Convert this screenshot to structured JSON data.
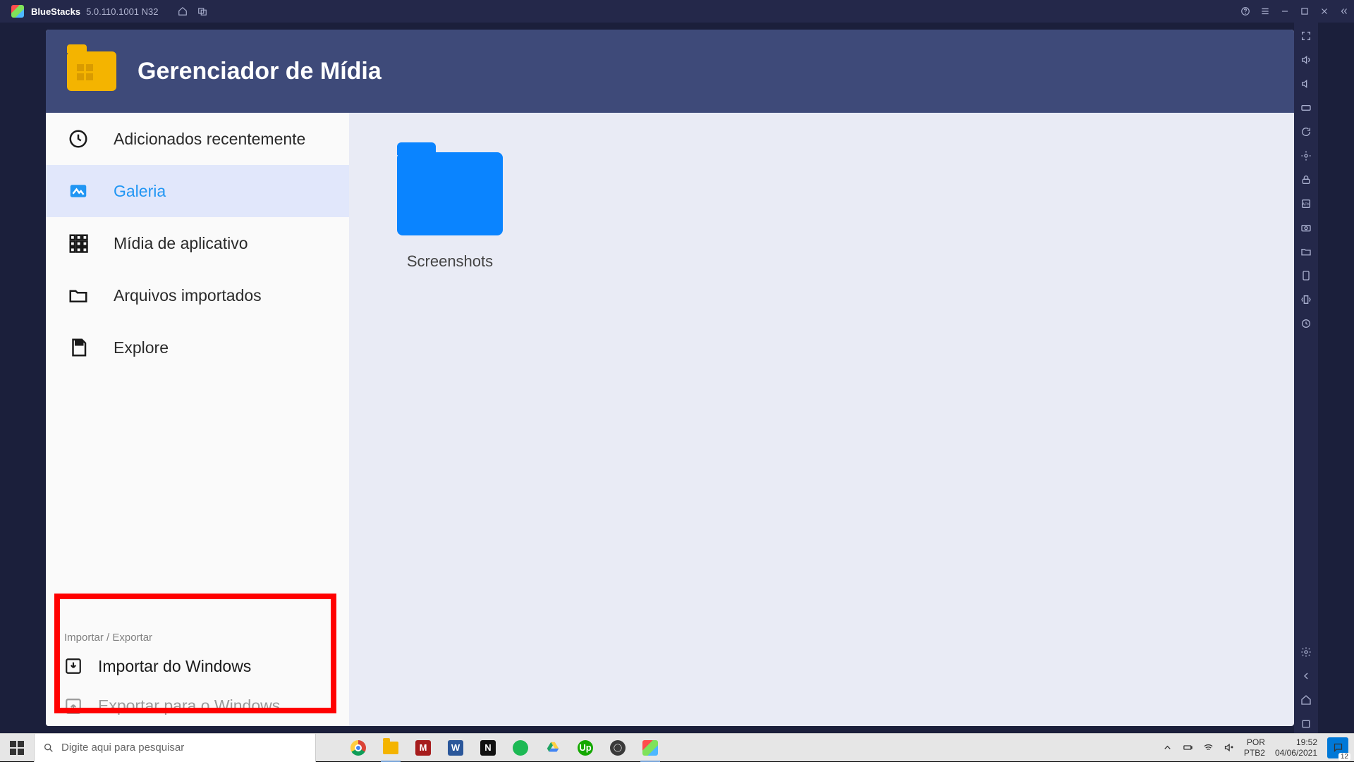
{
  "bluestacks": {
    "name": "BlueStacks",
    "version": "5.0.110.1001 N32"
  },
  "app": {
    "title": "Gerenciador de Mídia"
  },
  "sidebar": {
    "items": [
      {
        "label": "Adicionados recentemente"
      },
      {
        "label": "Galeria"
      },
      {
        "label": "Mídia de aplicativo"
      },
      {
        "label": "Arquivos importados"
      },
      {
        "label": "Explore"
      }
    ],
    "impexp_header": "Importar / Exportar",
    "impexp": [
      {
        "label": "Importar do Windows"
      },
      {
        "label": "Exportar para o Windows"
      }
    ]
  },
  "content": {
    "folders": [
      {
        "name": "Screenshots"
      }
    ]
  },
  "taskbar": {
    "search_placeholder": "Digite aqui para pesquisar",
    "lang1": "POR",
    "lang2": "PTB2",
    "time": "19:52",
    "date": "04/06/2021",
    "notif_count": "12"
  }
}
